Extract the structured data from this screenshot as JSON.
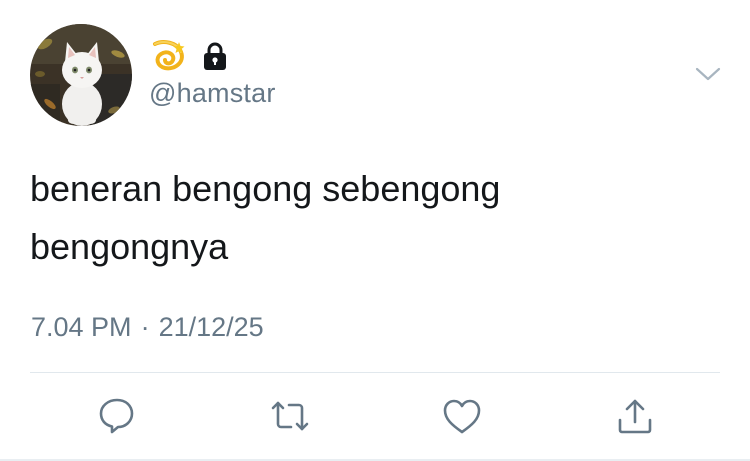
{
  "tweet": {
    "handle": "@hamstar",
    "text_lines": [
      "beneran bengong sebengong",
      "bengongnya"
    ],
    "time": "7.04 PM",
    "separator": "·",
    "date": "21/12/25"
  },
  "header": {
    "name_icons": [
      "dizzy-icon",
      "lock-icon"
    ],
    "menu_icon": "chevron-down-icon"
  },
  "actions": [
    "reply-icon",
    "retweet-icon",
    "like-icon",
    "share-icon"
  ],
  "colors": {
    "text": "#14171a",
    "secondary": "#657786",
    "icon": "#657786",
    "divider": "#e1e8ed"
  }
}
